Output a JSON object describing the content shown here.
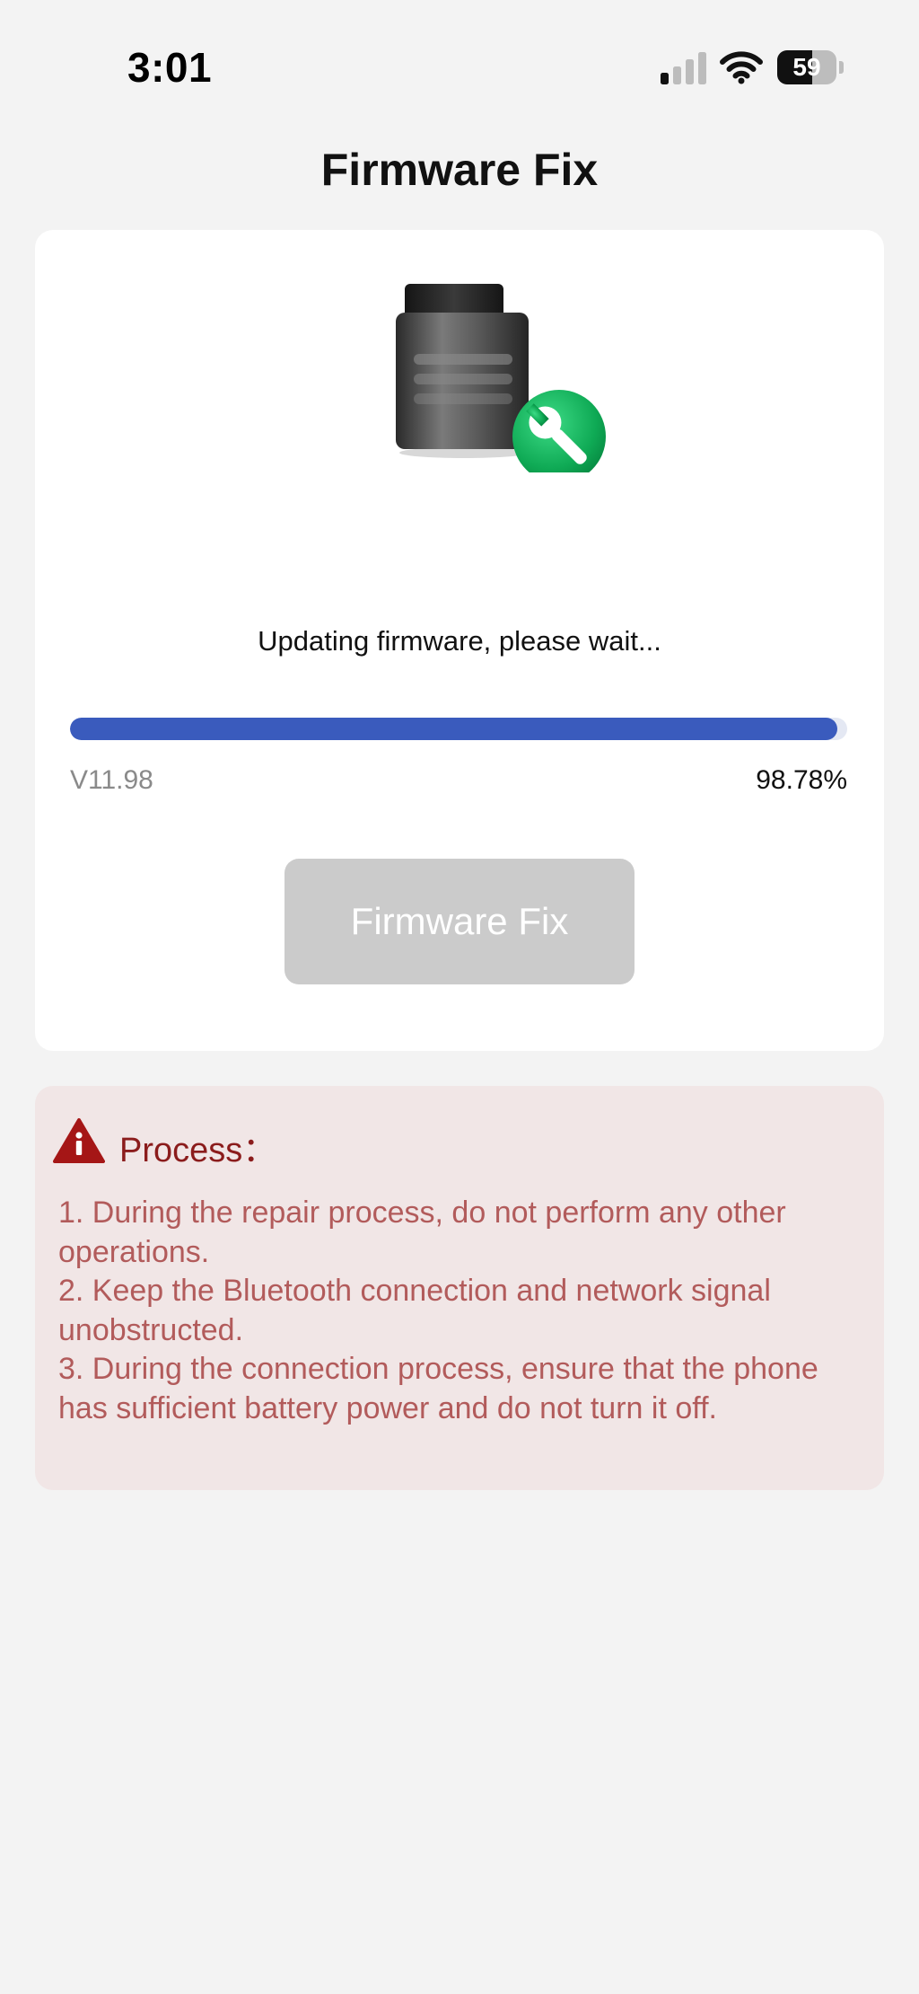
{
  "status_bar": {
    "time": "3:01",
    "battery_level": "59",
    "battery_fraction": 0.59,
    "signal_bars_active": 1,
    "signal_bars_total": 4
  },
  "header": {
    "title": "Firmware Fix"
  },
  "main": {
    "illustration_icon": "obd-device-with-wrench-icon",
    "status_message": "Updating firmware, please wait...",
    "progress_fraction": 0.9878,
    "version": "V11.98",
    "percent": "98.78%",
    "fix_button_label": "Firmware Fix",
    "fix_button_enabled": false
  },
  "notice": {
    "icon": "warning-icon",
    "title": "Process：",
    "items": [
      "1. During the repair process, do not perform any other operations.",
      "2. Keep the Bluetooth connection and network signal unobstructed.",
      "3. During the connection process, ensure that the phone has sufficient battery power and do not turn it off."
    ]
  },
  "colors": {
    "background": "#f3f3f3",
    "card": "#ffffff",
    "progress_fill": "#3a5bbd",
    "progress_track": "#e4e8f3",
    "button_disabled": "#cbcbcb",
    "notice_background": "#f1e6e6",
    "notice_title": "#8b1c1c",
    "notice_text": "#b25b5b",
    "wrench_badge": "#0faa55"
  }
}
